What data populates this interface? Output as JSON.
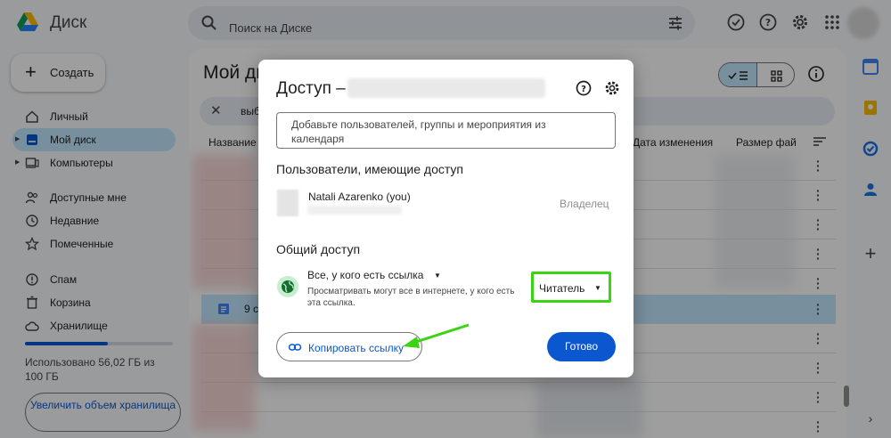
{
  "app": {
    "name": "Диск"
  },
  "search": {
    "placeholder": "Поиск на Диске"
  },
  "sidebar": {
    "new_label": "Создать",
    "items": [
      {
        "label": "Личный"
      },
      {
        "label": "Мой диск"
      },
      {
        "label": "Компьютеры"
      },
      {
        "label": "Доступные мне"
      },
      {
        "label": "Недавние"
      },
      {
        "label": "Помеченные"
      },
      {
        "label": "Спам"
      },
      {
        "label": "Корзина"
      },
      {
        "label": "Хранилище"
      }
    ],
    "storage": {
      "text": "Использовано 56,02 ГБ из 100 ГБ",
      "used_fraction": 0.56
    },
    "upgrade_label": "Увеличить объем хранилища"
  },
  "main": {
    "title": "Мой ди",
    "filter_text": "выбра",
    "columns": {
      "name": "Название",
      "modified": "Дата изменения",
      "size": "Размер фай"
    },
    "selected_row_text": "9 с"
  },
  "dialog": {
    "title": "Доступ –",
    "add_placeholder": "Добавьте пользователей, группы и мероприятия из календаря",
    "users_heading": "Пользователи, имеющие доступ",
    "user": {
      "name": "Natali Azarenko (you)",
      "role": "Владелец"
    },
    "general_heading": "Общий доступ",
    "access": {
      "label": "Все, у кого есть ссылка",
      "description": "Просматривать могут все в интернете, у кого есть эта ссылка.",
      "role": "Читатель"
    },
    "copy_link_label": "Копировать ссылку",
    "done_label": "Готово"
  },
  "colors": {
    "accent": "#0b57d0",
    "highlight": "#3ad414",
    "nav_active": "#c2e7ff"
  }
}
